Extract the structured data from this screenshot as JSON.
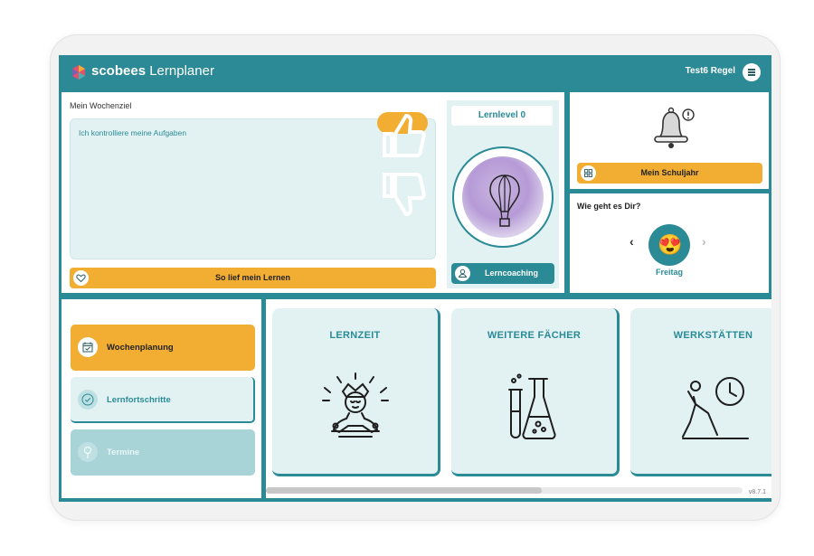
{
  "header": {
    "brand_bold": "scobees",
    "brand_light": "Lernplaner",
    "user_name": "Test6 Regel",
    "menu_icon": "hamburger-icon"
  },
  "wochenziel": {
    "title": "Mein Wochenziel",
    "text": "Ich kontrolliere meine Aufgaben",
    "button_label": "So lief mein Lernen"
  },
  "lernlevel": {
    "label": "Lernlevel 0",
    "button_label": "Lerncoaching"
  },
  "schuljahr": {
    "button_label": "Mein Schuljahr"
  },
  "mood": {
    "title": "Wie geht es Dir?",
    "prev": "‹",
    "next": "›",
    "emoji": "😍",
    "day": "Freitag"
  },
  "sidebar": {
    "items": [
      {
        "label": "Wochenplanung",
        "icon": "calendar-check-icon",
        "active": true
      },
      {
        "label": "Lernfortschritte",
        "icon": "check-circle-icon",
        "active": false
      },
      {
        "label": "Termine",
        "icon": "pin-icon",
        "active": false
      }
    ]
  },
  "tiles": [
    {
      "label": "LERNZEIT",
      "icon": "meditating-person-icon"
    },
    {
      "label": "WEITERE FÄCHER",
      "icon": "lab-flask-icon"
    },
    {
      "label": "WERKSTÄTTEN",
      "icon": "stretching-clock-icon"
    }
  ],
  "version": "v8.7.1",
  "colors": {
    "teal": "#2a8b96",
    "yellow": "#f2ae33",
    "light_teal": "#e2f2f3"
  }
}
